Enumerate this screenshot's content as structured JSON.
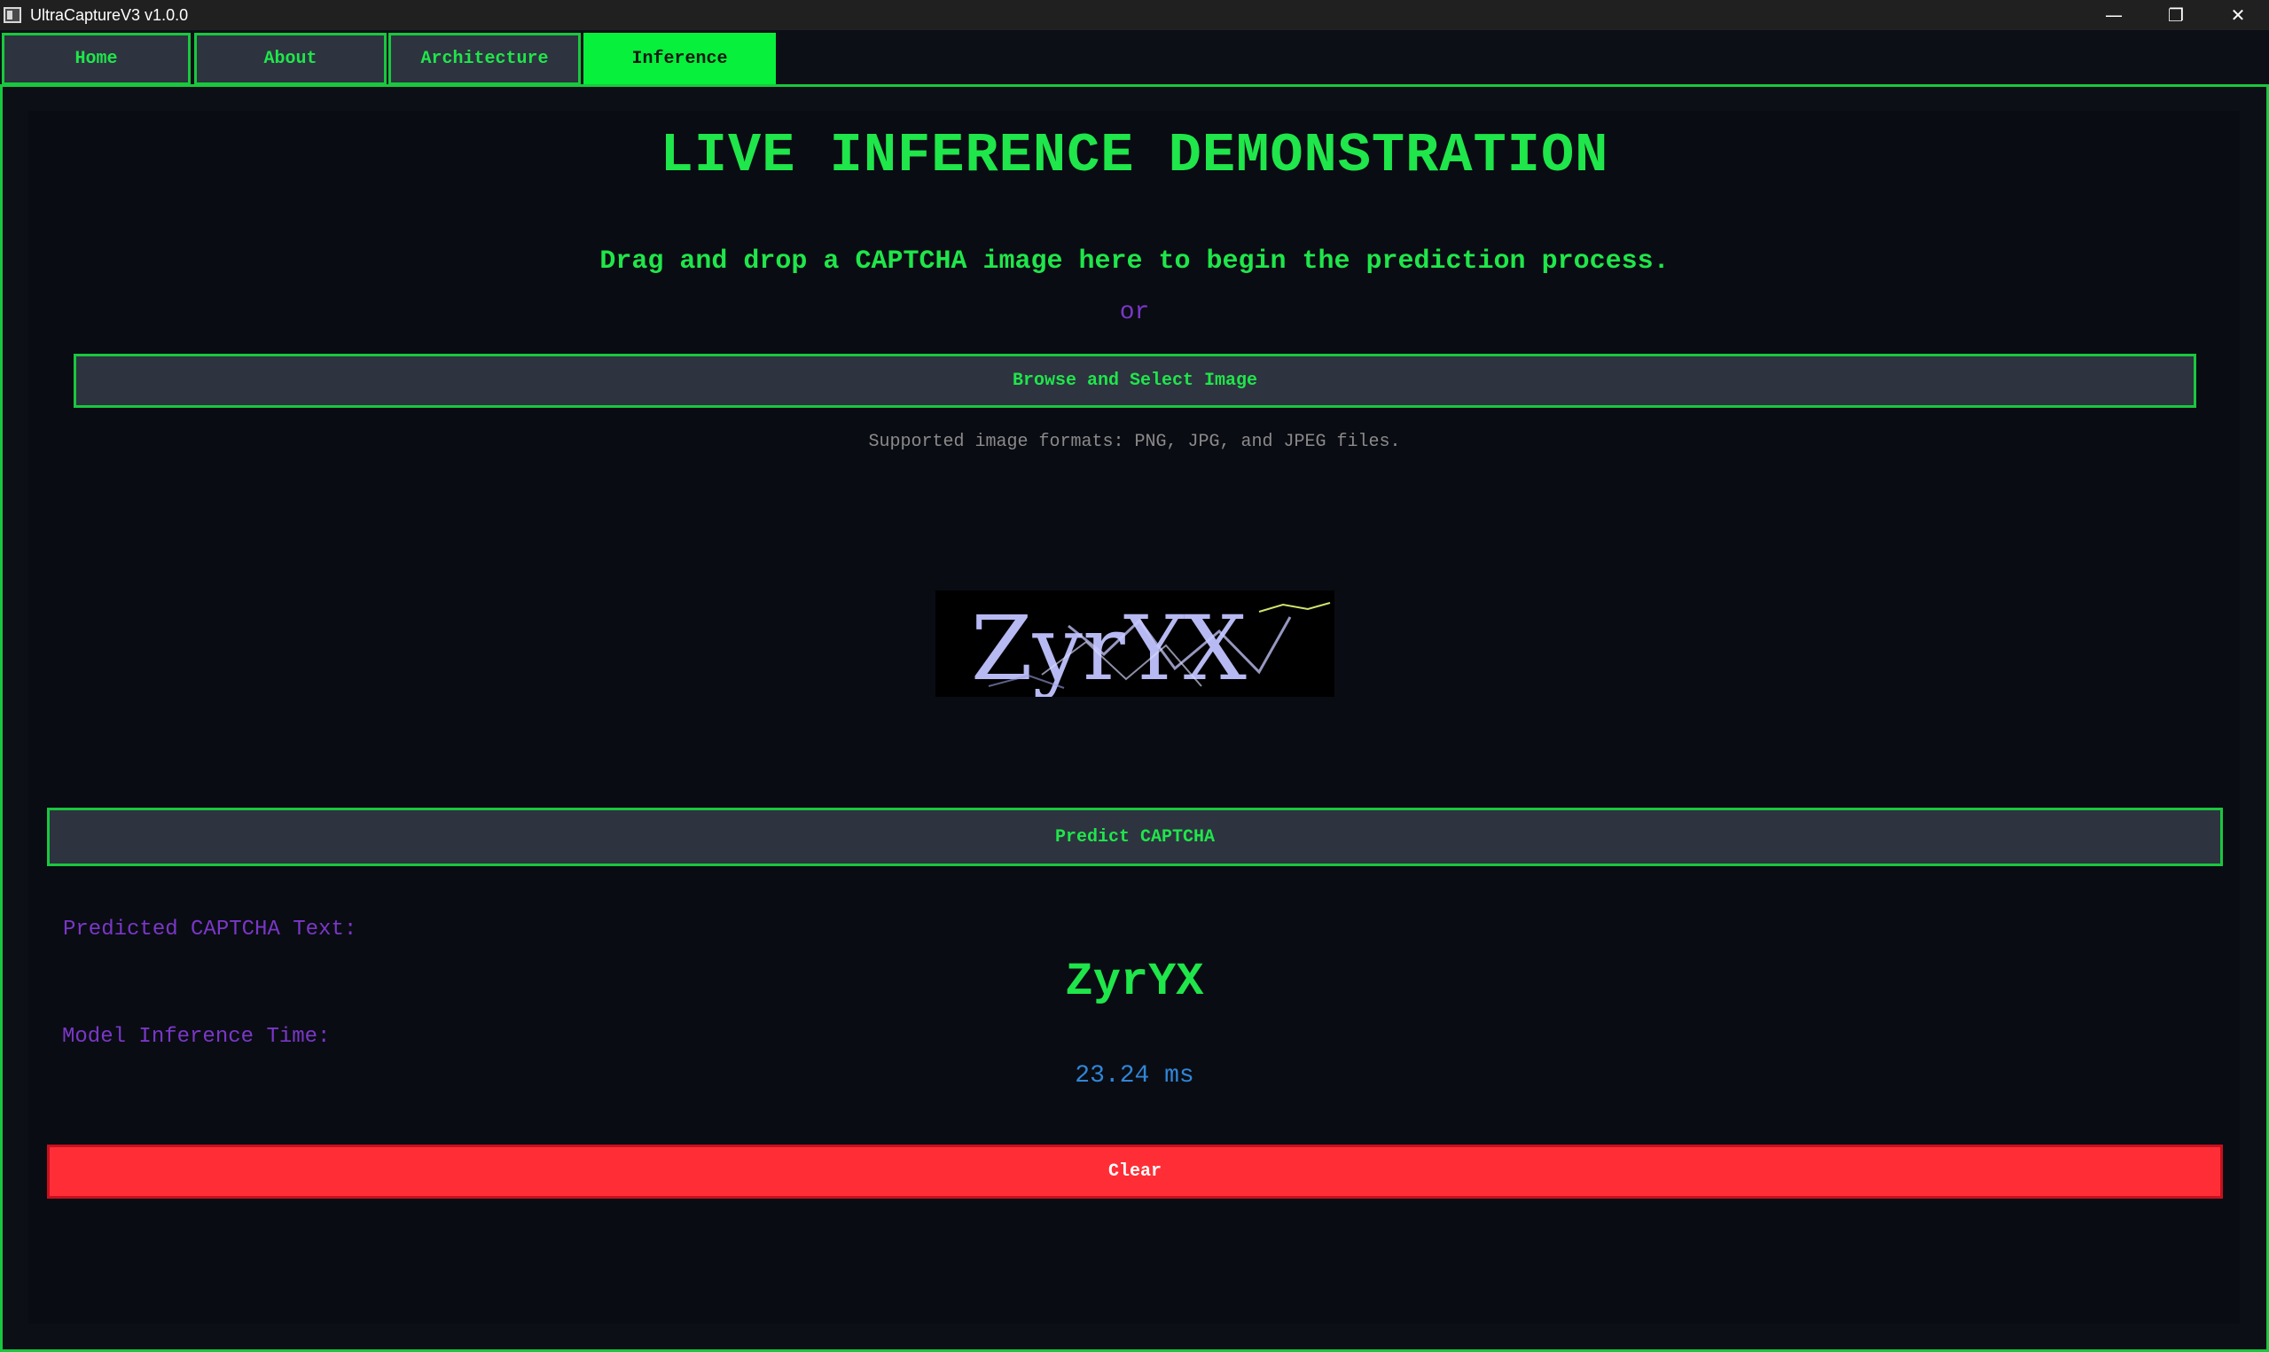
{
  "window": {
    "title": "UltraCaptureV3 v1.0.0",
    "controls": {
      "minimize": "—",
      "restore": "❐",
      "close": "✕"
    }
  },
  "tabs": [
    {
      "label": "Home",
      "active": false
    },
    {
      "label": "About",
      "active": false
    },
    {
      "label": "Architecture",
      "active": false
    },
    {
      "label": "Inference",
      "active": true
    }
  ],
  "main": {
    "heading": "LIVE INFERENCE DEMONSTRATION",
    "subtitle": "Drag and drop a CAPTCHA image here to begin the prediction process.",
    "or_text": "or",
    "browse_label": "Browse and Select Image",
    "formats_text": "Supported image formats: PNG, JPG, and JPEG files.",
    "captcha_image_text": "ZyrYX",
    "predict_label": "Predict CAPTCHA",
    "predicted_label": "Predicted CAPTCHA Text:",
    "predicted_value": "ZyrYX",
    "time_label": "Model Inference Time:",
    "time_value": "23.24 ms",
    "clear_label": "Clear"
  },
  "colors": {
    "accent_green": "#1fe64a",
    "active_tab": "#06f03c",
    "purple_label": "#7a37c8",
    "time_blue": "#2f86d8",
    "clear_red": "#ff2e36",
    "background": "#0a0c13"
  }
}
